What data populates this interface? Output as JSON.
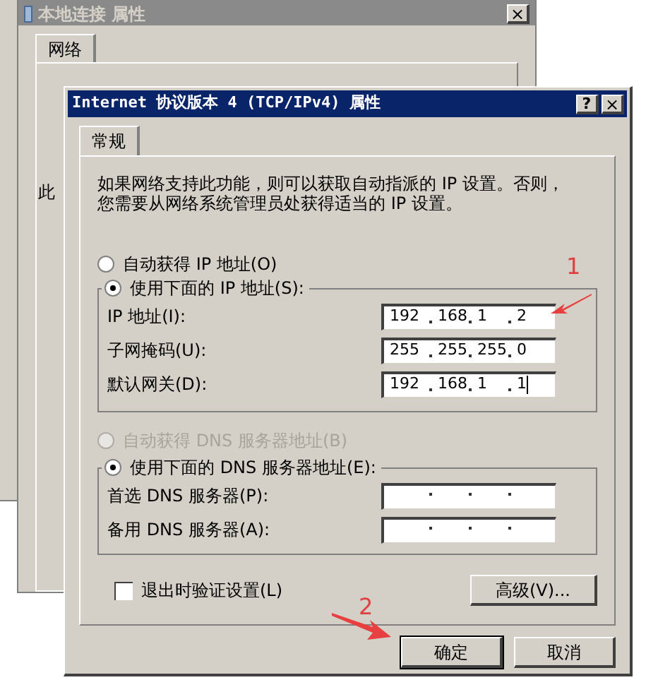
{
  "back_window": {
    "title": "本地连接 属性",
    "tabs": [
      {
        "label": "网络",
        "selected": true
      }
    ],
    "partial_label": "此"
  },
  "window": {
    "title": "Internet 协议版本 4 (TCP/IPv4) 属性",
    "help": "?",
    "close": "×"
  },
  "tabs": [
    {
      "label": "常规",
      "selected": true
    }
  ],
  "description": "如果网络支持此功能，则可以获取自动指派的 IP 设置。否则，您需要从网络系统管理员处获得适当的 IP 设置。",
  "ip_mode": [
    {
      "label": "自动获得 IP 地址(O)",
      "selected": false,
      "disabled": false
    },
    {
      "label": "使用下面的 IP 地址(S):",
      "selected": true,
      "disabled": false
    }
  ],
  "ip_fields": [
    {
      "label": "IP 地址(I):",
      "octets": [
        "192",
        "168",
        "1",
        "2"
      ],
      "caret": false
    },
    {
      "label": "子网掩码(U):",
      "octets": [
        "255",
        "255",
        "255",
        "0"
      ],
      "caret": false
    },
    {
      "label": "默认网关(D):",
      "octets": [
        "192",
        "168",
        "1",
        "1"
      ],
      "caret": true
    }
  ],
  "dns_mode": [
    {
      "label": "自动获得 DNS 服务器地址(B)",
      "selected": false,
      "disabled": true
    },
    {
      "label": "使用下面的 DNS 服务器地址(E):",
      "selected": true,
      "disabled": false
    }
  ],
  "dns_fields": [
    {
      "label": "首选 DNS 服务器(P):",
      "caret": false
    },
    {
      "label": "备用 DNS 服务器(A):",
      "caret": false
    }
  ],
  "validate_on_exit": {
    "label": "退出时验证设置(L)",
    "checked": false
  },
  "advanced_button": "高级(V)...",
  "buttons": [
    {
      "label": "确定",
      "selected": true
    },
    {
      "label": "取消",
      "selected": false
    }
  ],
  "annotations": [
    {
      "label": "1"
    },
    {
      "label": "2"
    }
  ]
}
